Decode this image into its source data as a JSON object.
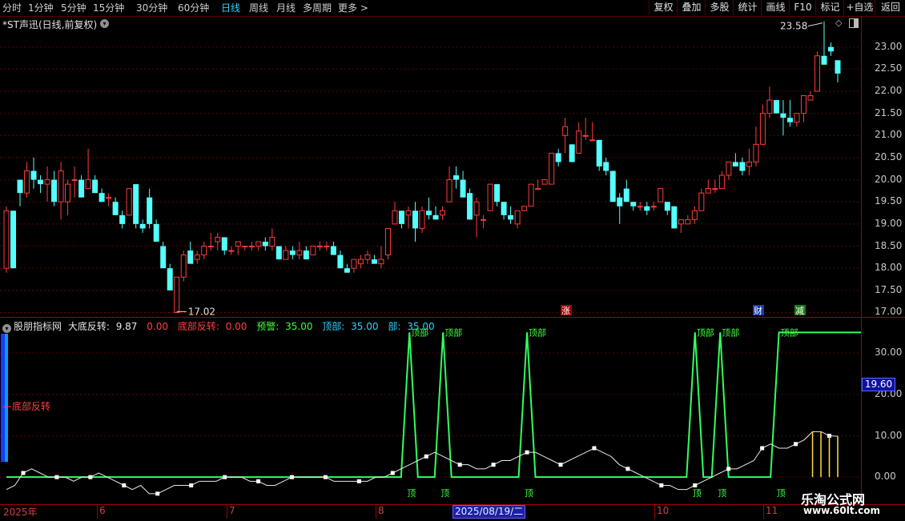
{
  "toolbar": {
    "periods": [
      "分时",
      "1分钟",
      "5分钟",
      "15分钟",
      "30分钟",
      "60分钟",
      "日线",
      "周线",
      "月线",
      "多周期",
      "更多 >"
    ],
    "active_period": "日线",
    "right_buttons": [
      "复权",
      "叠加",
      "多股",
      "统计",
      "画线",
      "F10",
      "标记",
      "+自选",
      "返回"
    ]
  },
  "main": {
    "title": "*ST声迅(日线,前复权)",
    "y_ticks": [
      "23.00",
      "22.50",
      "22.00",
      "21.50",
      "21.00",
      "20.50",
      "20.00",
      "19.50",
      "19.00",
      "18.50",
      "18.00",
      "17.50",
      "17.00"
    ],
    "high_label": "23.58",
    "low_label": "17.02",
    "event_marks": [
      "涨",
      "财",
      "减"
    ]
  },
  "indicator": {
    "name": "股朋指标网",
    "items": [
      {
        "label": "大底反转:",
        "value": "9.87",
        "color": "#e8e8e8"
      },
      {
        "label": "",
        "value": "0.00",
        "color": "#ff4040"
      },
      {
        "label": "底部反转:",
        "value": "0.00",
        "color": "#ff4040"
      },
      {
        "label": "预警:",
        "value": "35.00",
        "color": "#40ff40"
      },
      {
        "label": "顶部:",
        "value": "35.00",
        "color": "#2fd2ff"
      },
      {
        "label": "部:",
        "value": "35.00",
        "color": "#2fd2ff"
      }
    ],
    "y_ticks": [
      "30.00",
      "20.00",
      "10.00",
      "0.00"
    ],
    "current_value": "19.60",
    "bottom_signal_label": "底部反转",
    "top_label": "顶部",
    "top_short": "顶"
  },
  "date_axis": {
    "ticks": [
      "2025年",
      "6",
      "7",
      "8",
      "9",
      "10",
      "11"
    ],
    "cursor_date": "2025/08/19/二"
  },
  "watermark": {
    "name": "乐淘公式网",
    "url": "www.60lt.com"
  },
  "chart_data": [
    {
      "type": "candlestick",
      "title": "*ST声迅(日线,前复权)",
      "ylim": [
        16.9,
        23.7
      ],
      "annotations": {
        "max": 23.58,
        "min": 17.02
      },
      "candles": [
        [
          18.0,
          19.4,
          17.9,
          19.3
        ],
        [
          19.3,
          19.3,
          18.0,
          18.0
        ],
        [
          20.0,
          20.0,
          19.4,
          19.7
        ],
        [
          19.7,
          20.4,
          19.6,
          20.2
        ],
        [
          20.2,
          20.5,
          19.8,
          20.0
        ],
        [
          20.0,
          20.1,
          19.7,
          19.9
        ],
        [
          19.9,
          20.3,
          19.5,
          20.0
        ],
        [
          20.0,
          20.2,
          19.4,
          19.5
        ],
        [
          19.5,
          20.4,
          19.1,
          20.2
        ],
        [
          19.5,
          20.0,
          19.2,
          19.9
        ],
        [
          20.0,
          20.3,
          19.6,
          20.0
        ],
        [
          20.0,
          20.1,
          19.6,
          19.6
        ],
        [
          19.8,
          20.7,
          19.8,
          20.0
        ],
        [
          20.0,
          20.1,
          19.7,
          19.7
        ],
        [
          19.7,
          19.8,
          19.5,
          19.5
        ],
        [
          19.6,
          19.7,
          19.4,
          19.6
        ],
        [
          19.5,
          19.6,
          19.3,
          19.2
        ],
        [
          19.2,
          19.3,
          18.9,
          19.0
        ],
        [
          19.2,
          19.8,
          19.2,
          19.8
        ],
        [
          19.9,
          19.9,
          18.9,
          19.0
        ],
        [
          19.0,
          19.1,
          18.8,
          18.9
        ],
        [
          19.6,
          19.8,
          18.9,
          19.0
        ],
        [
          19.0,
          19.1,
          18.6,
          18.6
        ],
        [
          18.5,
          18.6,
          18.0,
          18.0
        ],
        [
          18.0,
          18.1,
          17.5,
          17.5
        ],
        [
          17.0,
          17.8,
          17.02,
          17.8
        ],
        [
          17.8,
          18.4,
          17.7,
          18.3
        ],
        [
          18.4,
          18.6,
          18.1,
          18.1
        ],
        [
          18.2,
          18.4,
          18.1,
          18.3
        ],
        [
          18.3,
          18.6,
          18.2,
          18.5
        ],
        [
          18.5,
          18.8,
          18.4,
          18.5
        ],
        [
          18.6,
          18.8,
          18.4,
          18.7
        ],
        [
          18.7,
          18.7,
          18.3,
          18.4
        ],
        [
          18.4,
          18.5,
          18.3,
          18.4
        ],
        [
          18.5,
          18.6,
          18.3,
          18.6
        ],
        [
          18.5,
          18.5,
          18.4,
          18.5
        ],
        [
          18.5,
          18.6,
          18.4,
          18.5
        ],
        [
          18.5,
          18.6,
          18.4,
          18.6
        ],
        [
          18.6,
          18.7,
          18.4,
          18.5
        ],
        [
          18.5,
          18.9,
          18.4,
          18.7
        ],
        [
          18.5,
          18.5,
          18.2,
          18.2
        ],
        [
          18.2,
          18.5,
          18.2,
          18.4
        ],
        [
          18.4,
          18.5,
          18.2,
          18.3
        ],
        [
          18.3,
          18.6,
          18.2,
          18.4
        ],
        [
          18.4,
          18.5,
          18.2,
          18.2
        ],
        [
          18.3,
          18.5,
          18.3,
          18.5
        ],
        [
          18.5,
          18.6,
          18.4,
          18.5
        ],
        [
          18.5,
          18.6,
          18.4,
          18.5
        ],
        [
          18.5,
          18.6,
          18.3,
          18.3
        ],
        [
          18.3,
          18.4,
          18.0,
          18.0
        ],
        [
          18.0,
          18.1,
          17.9,
          17.9
        ],
        [
          18.0,
          18.2,
          17.9,
          18.2
        ],
        [
          18.1,
          18.3,
          18.0,
          18.2
        ],
        [
          18.2,
          18.4,
          18.1,
          18.3
        ],
        [
          18.2,
          18.3,
          18.1,
          18.1
        ],
        [
          18.1,
          18.5,
          18.0,
          18.2
        ],
        [
          18.3,
          18.9,
          18.2,
          18.9
        ],
        [
          19.0,
          19.5,
          19.0,
          19.3
        ],
        [
          19.3,
          19.3,
          18.9,
          19.0
        ],
        [
          19.2,
          19.4,
          18.9,
          19.3
        ],
        [
          19.3,
          19.5,
          18.6,
          18.9
        ],
        [
          18.9,
          19.4,
          18.8,
          19.3
        ],
        [
          19.3,
          19.6,
          19.1,
          19.2
        ],
        [
          19.2,
          19.4,
          19.1,
          19.1
        ],
        [
          19.2,
          19.4,
          19.1,
          19.3
        ],
        [
          19.5,
          20.3,
          19.5,
          20.0
        ],
        [
          20.1,
          20.3,
          19.8,
          20.0
        ],
        [
          20.0,
          20.2,
          19.6,
          19.6
        ],
        [
          19.7,
          19.8,
          19.1,
          19.1
        ],
        [
          19.2,
          19.6,
          18.7,
          19.5
        ],
        [
          19.1,
          19.2,
          18.9,
          19.1
        ],
        [
          19.3,
          19.9,
          19.3,
          19.9
        ],
        [
          19.9,
          19.9,
          19.4,
          19.5
        ],
        [
          19.5,
          19.5,
          19.1,
          19.2
        ],
        [
          19.2,
          19.4,
          19.0,
          19.1
        ],
        [
          19.0,
          19.3,
          18.9,
          19.3
        ],
        [
          19.3,
          19.4,
          19.3,
          19.4
        ],
        [
          19.4,
          19.9,
          19.4,
          19.9
        ],
        [
          19.8,
          20.0,
          19.8,
          19.8
        ],
        [
          19.9,
          20.0,
          19.9,
          20.0
        ],
        [
          19.9,
          20.6,
          19.9,
          20.6
        ],
        [
          20.6,
          20.7,
          20.3,
          20.4
        ],
        [
          21.0,
          21.4,
          20.6,
          21.2
        ],
        [
          20.8,
          20.8,
          20.4,
          20.4
        ],
        [
          20.6,
          21.3,
          20.6,
          21.1
        ],
        [
          21.0,
          21.4,
          20.9,
          21.0
        ],
        [
          20.9,
          21.3,
          20.9,
          20.9
        ],
        [
          20.9,
          20.9,
          20.2,
          20.3
        ],
        [
          20.4,
          20.5,
          20.1,
          20.2
        ],
        [
          20.2,
          20.2,
          19.5,
          19.5
        ],
        [
          19.6,
          19.7,
          19.0,
          19.4
        ],
        [
          19.8,
          20.0,
          19.5,
          19.5
        ],
        [
          19.5,
          19.5,
          19.3,
          19.4
        ],
        [
          19.4,
          19.5,
          19.3,
          19.4
        ],
        [
          19.4,
          19.5,
          19.2,
          19.3
        ],
        [
          19.4,
          19.5,
          19.3,
          19.4
        ],
        [
          19.5,
          19.8,
          19.5,
          19.8
        ],
        [
          19.5,
          19.5,
          19.2,
          19.3
        ],
        [
          19.4,
          19.4,
          18.9,
          18.9
        ],
        [
          19.0,
          19.1,
          18.8,
          19.1
        ],
        [
          19.0,
          19.2,
          19.0,
          19.1
        ],
        [
          19.1,
          19.4,
          19.0,
          19.3
        ],
        [
          19.3,
          19.8,
          19.3,
          19.7
        ],
        [
          19.7,
          20.0,
          19.7,
          19.8
        ],
        [
          19.8,
          20.0,
          19.7,
          19.8
        ],
        [
          19.8,
          20.2,
          19.8,
          20.1
        ],
        [
          20.1,
          20.4,
          20.0,
          20.4
        ],
        [
          20.4,
          20.6,
          20.3,
          20.3
        ],
        [
          20.4,
          20.5,
          20.1,
          20.2
        ],
        [
          20.3,
          20.7,
          20.1,
          20.4
        ],
        [
          20.4,
          21.2,
          20.3,
          20.8
        ],
        [
          20.8,
          21.7,
          20.8,
          21.5
        ],
        [
          21.5,
          22.1,
          21.4,
          21.8
        ],
        [
          21.8,
          21.8,
          21.5,
          21.5
        ],
        [
          21.5,
          21.8,
          21.0,
          21.4
        ],
        [
          21.4,
          21.8,
          21.2,
          21.3
        ],
        [
          21.3,
          21.5,
          21.2,
          21.5
        ],
        [
          21.5,
          21.9,
          21.3,
          21.9
        ],
        [
          21.8,
          22.0,
          21.8,
          21.9
        ],
        [
          22.0,
          22.9,
          22.0,
          22.8
        ],
        [
          22.8,
          23.58,
          22.6,
          22.6
        ],
        [
          23.0,
          23.1,
          22.8,
          22.9
        ],
        [
          22.7,
          22.7,
          22.2,
          22.4
        ]
      ]
    },
    {
      "type": "line",
      "title": "股朋指标网",
      "ylim": [
        -5,
        37
      ],
      "x": [
        "2025年",
        "6",
        "7",
        "8",
        "9",
        "10",
        "11"
      ],
      "series": [
        {
          "name": "大底反转",
          "values": [
            -3,
            -2,
            1,
            2,
            1,
            0,
            0,
            0,
            -1,
            0,
            0,
            1,
            0,
            -1,
            -2,
            -3,
            -2,
            -4,
            -4,
            -3,
            -2,
            -2,
            -2,
            -1,
            -1,
            -1,
            0,
            0,
            0,
            -1,
            -1,
            -2,
            -2,
            -1,
            0,
            0,
            0,
            0,
            0,
            -1,
            -1,
            -1,
            -1,
            -1,
            0,
            0,
            1,
            2,
            3,
            4,
            5,
            6,
            5,
            4,
            3,
            3,
            2,
            2,
            3,
            4,
            4,
            5,
            6,
            6,
            5,
            4,
            3,
            4,
            5,
            6,
            7,
            6,
            5,
            3,
            2,
            1,
            0,
            -1,
            -2,
            -2,
            -3,
            -3,
            -2,
            -1,
            0,
            1,
            2,
            2,
            3,
            4,
            7,
            8,
            7,
            7,
            8,
            9,
            11,
            11,
            10,
            9.87
          ]
        },
        {
          "name": "预警",
          "values": [
            0,
            0,
            0,
            0,
            0,
            0,
            0,
            0,
            0,
            0,
            0,
            0,
            0,
            0,
            0,
            0,
            0,
            0,
            0,
            0,
            0,
            0,
            0,
            0,
            0,
            0,
            0,
            0,
            0,
            0,
            0,
            0,
            0,
            0,
            0,
            0,
            0,
            0,
            0,
            0,
            0,
            0,
            0,
            0,
            0,
            0,
            0,
            0,
            35,
            0,
            0,
            0,
            35,
            0,
            0,
            0,
            0,
            0,
            0,
            0,
            0,
            0,
            35,
            0,
            0,
            0,
            0,
            0,
            0,
            0,
            0,
            0,
            0,
            0,
            0,
            0,
            0,
            0,
            0,
            0,
            0,
            0,
            35,
            0,
            0,
            35,
            0,
            0,
            0,
            0,
            0,
            0,
            35,
            35,
            35,
            35,
            35,
            35,
            35,
            35,
            35,
            35,
            35
          ]
        }
      ]
    }
  ]
}
